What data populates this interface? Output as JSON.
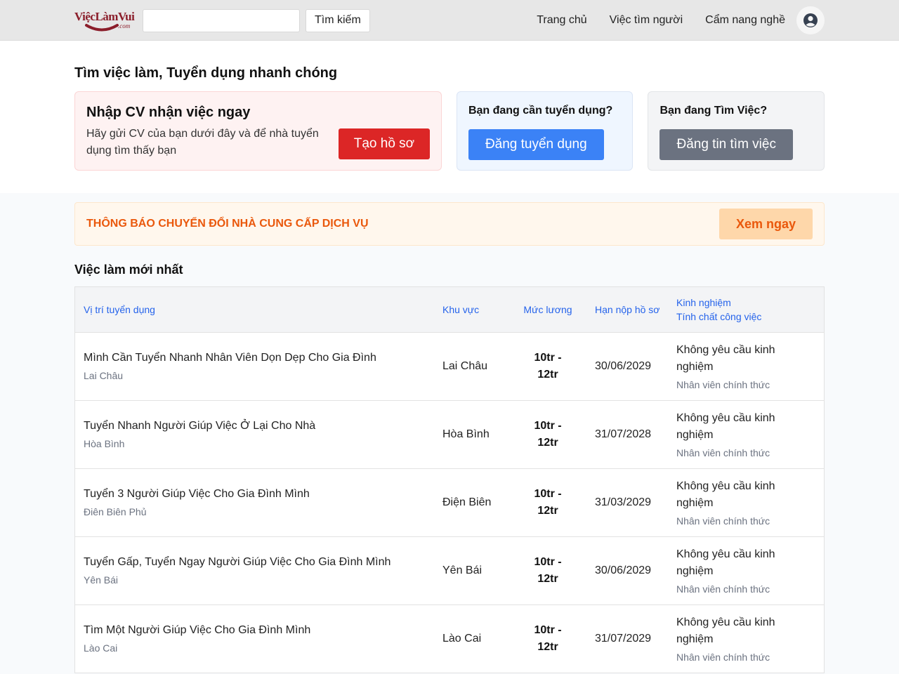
{
  "header": {
    "logo_text": "ViệcLàmVui",
    "logo_suffix": ".com",
    "search_placeholder": "",
    "search_button": "Tìm kiếm",
    "nav": [
      "Trang chủ",
      "Việc tìm người",
      "Cẩm nang nghề"
    ],
    "avatar_icon": "user-circle-icon"
  },
  "hero": {
    "title": "Tìm việc làm, Tuyển dụng nhanh chóng",
    "cv_card": {
      "heading": "Nhập CV nhận việc ngay",
      "text": "Hãy gửi CV của bạn dưới đây và để nhà tuyển dụng tìm thấy bạn",
      "button": "Tạo hồ sơ"
    },
    "hire_card": {
      "heading": "Bạn đang cần tuyển dụng?",
      "button": "Đăng tuyển dụng"
    },
    "seek_card": {
      "heading": "Bạn đang Tìm Việc?",
      "button": "Đăng tin tìm việc"
    }
  },
  "notice": {
    "text": "THÔNG BÁO CHUYỂN ĐỔI NHÀ CUNG CẤP DỊCH VỤ",
    "button": "Xem ngay"
  },
  "jobs": {
    "title": "Việc làm mới nhất",
    "headers": {
      "position": "Vị trí tuyển dụng",
      "area": "Khu vực",
      "salary": "Mức lương",
      "deadline": "Hạn nộp hồ sơ",
      "experience": "Kinh nghiệm",
      "type": "Tính chất công việc"
    },
    "rows": [
      {
        "title": "Mình Cần Tuyển Nhanh Nhân Viên Dọn Dẹp Cho Gia Đình",
        "location": "Lai Châu",
        "area": "Lai Châu",
        "salary_line1": "10tr -",
        "salary_line2": "12tr",
        "deadline": "30/06/2029",
        "experience": "Không yêu cầu kinh nghiệm",
        "type": "Nhân viên chính thức"
      },
      {
        "title": "Tuyển Nhanh Người Giúp Việc Ở Lại Cho Nhà",
        "location": "Hòa Bình",
        "area": "Hòa Bình",
        "salary_line1": "10tr -",
        "salary_line2": "12tr",
        "deadline": "31/07/2028",
        "experience": "Không yêu cầu kinh nghiệm",
        "type": "Nhân viên chính thức"
      },
      {
        "title": "Tuyển 3 Người Giúp Việc Cho Gia Đình Mình",
        "location": "Điên Biên Phủ",
        "area": "Điện Biên",
        "salary_line1": "10tr -",
        "salary_line2": "12tr",
        "deadline": "31/03/2029",
        "experience": "Không yêu cầu kinh nghiệm",
        "type": "Nhân viên chính thức"
      },
      {
        "title": "Tuyển Gấp, Tuyển Ngay Người Giúp Việc Cho Gia Đình Mình",
        "location": "Yên Bái",
        "area": "Yên Bái",
        "salary_line1": "10tr -",
        "salary_line2": "12tr",
        "deadline": "30/06/2029",
        "experience": "Không yêu cầu kinh nghiệm",
        "type": "Nhân viên chính thức"
      },
      {
        "title": "Tìm Một Người Giúp Việc Cho Gia Đình Mình",
        "location": "Lào Cai",
        "area": "Lào Cai",
        "salary_line1": "10tr -",
        "salary_line2": "12tr",
        "deadline": "31/07/2029",
        "experience": "Không yêu cầu kinh nghiệm",
        "type": "Nhân viên chính thức"
      }
    ]
  }
}
